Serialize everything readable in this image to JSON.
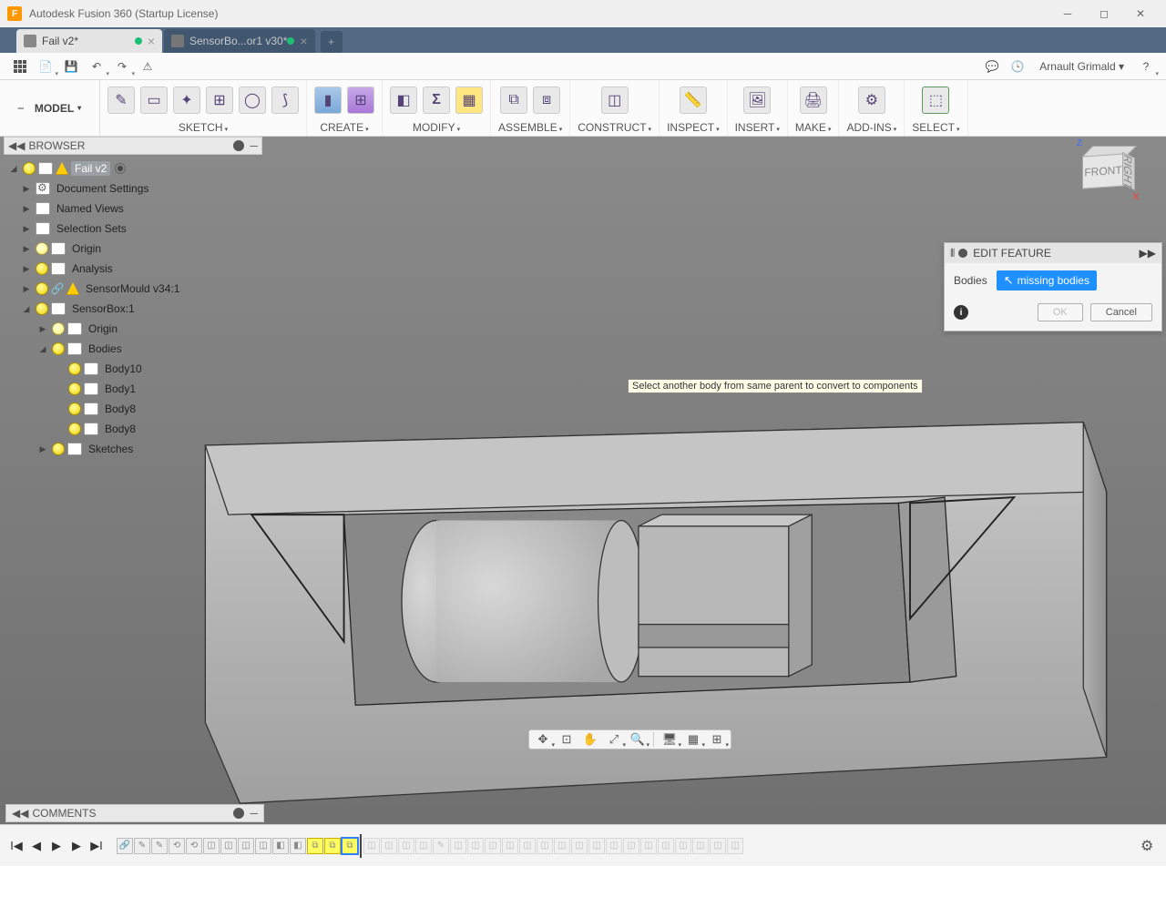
{
  "title": "Autodesk Fusion 360 (Startup License)",
  "tabs": [
    {
      "label": "Fail v2*",
      "active": true
    },
    {
      "label": "SensorBo...or1 v30*",
      "active": false
    }
  ],
  "username": "Arnault Grimald",
  "workspace": "MODEL",
  "ribbon": [
    {
      "label": "SKETCH",
      "icons": 6
    },
    {
      "label": "CREATE",
      "icons": 2
    },
    {
      "label": "MODIFY",
      "icons": 3
    },
    {
      "label": "ASSEMBLE",
      "icons": 2
    },
    {
      "label": "CONSTRUCT",
      "icons": 1
    },
    {
      "label": "INSPECT",
      "icons": 1
    },
    {
      "label": "INSERT",
      "icons": 1
    },
    {
      "label": "MAKE",
      "icons": 1
    },
    {
      "label": "ADD-INS",
      "icons": 1
    },
    {
      "label": "SELECT",
      "icons": 1
    }
  ],
  "browser_title": "BROWSER",
  "tree": {
    "root": "Fail v2",
    "docset": "Document Settings",
    "named": "Named Views",
    "selsets": "Selection Sets",
    "origin": "Origin",
    "analysis": "Analysis",
    "comp1": "SensorMould v34:1",
    "comp2": "SensorBox:1",
    "origin2": "Origin",
    "bodies": "Bodies",
    "b1": "Body10",
    "b2": "Body1",
    "b3": "Body8",
    "b4": "Body8",
    "sketches": "Sketches"
  },
  "tooltip": "Select another body from same parent to convert to components",
  "editfeature": {
    "title": "EDIT FEATURE",
    "row_label": "Bodies",
    "chip": "missing bodies",
    "ok": "OK",
    "cancel": "Cancel"
  },
  "comments": "COMMENTS",
  "viewcube": {
    "front": "FRONT",
    "right": "RIGHT"
  }
}
